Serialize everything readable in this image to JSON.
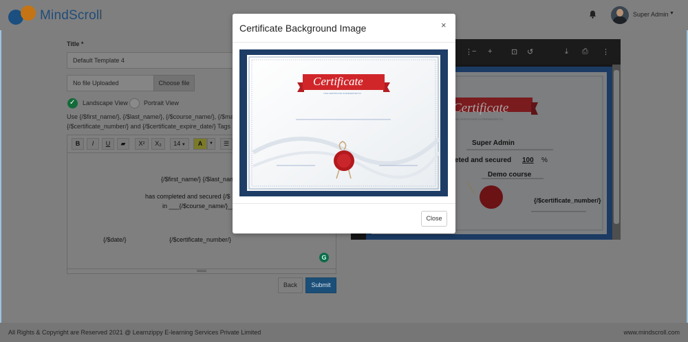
{
  "header": {
    "brand": "MindScroll",
    "user_name": "Super Admin"
  },
  "form": {
    "title_label": "Title *",
    "title_value": "Default Template 4",
    "file_status": "No file Uploaded",
    "choose_file": "Choose file",
    "view_landscape": "Landscape View",
    "view_portrait": "Portrait View",
    "selected_view": "landscape",
    "tags_line1": "Use {/$first_name/}, {/$last_name/}, {/$course_name/}, {/$mar",
    "tags_line2": "{/$certificate_number/} and {/$certificate_expire_date/} Tags",
    "toolbar": {
      "bold": "B",
      "italic": "I",
      "underline": "U",
      "superscript": "X²",
      "subscript": "X₂",
      "font_size": "14",
      "font_color": "A"
    },
    "editor": {
      "line_name": "{/$first_name/} {/$last_name/",
      "line_completed": "has completed and secured {/$",
      "line_course": "in ___{/$course_name/}___",
      "line_date": "{/$date/}",
      "line_cert_number": "{/$certificate_number/}"
    },
    "back_label": "Back",
    "submit_label": "Submit"
  },
  "preview": {
    "cert_title": "Certificate",
    "cert_subtitle": "THIS CERTIFICATE IS PRESENTED TO",
    "user": "Super Admin",
    "completed_prefix": "pleted and secured",
    "percent": "100",
    "percent_sign": "%",
    "course": "Demo course",
    "cert_number": "{/$certificate_number/}"
  },
  "modal": {
    "title": "Certificate Background Image",
    "close_x": "×",
    "cert_title": "Certificate",
    "cert_subtitle": "THIS CERTIFICATE IS PRESENTED TO",
    "close_label": "Close"
  },
  "footer": {
    "copyright": "All Rights & Copyright are Reserved 2021 @ Learnzippy E-learning Services Private Limited",
    "site": "www.mindscroll.com"
  },
  "colors": {
    "brand_blue": "#1f4c78",
    "brand_orange": "#c47414",
    "submit_blue": "#1c4f78",
    "cert_border": "#1b3b63",
    "ribbon_red": "#d0262a"
  }
}
